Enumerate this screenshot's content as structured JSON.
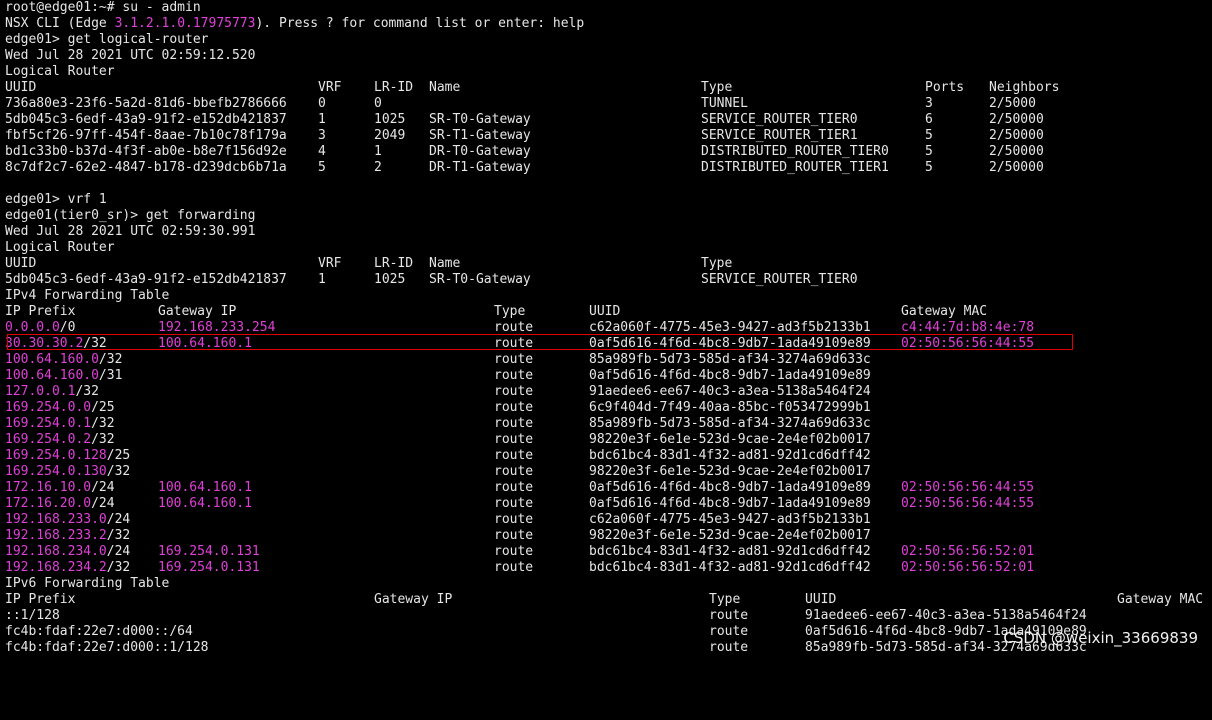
{
  "session": {
    "l1": "root@edge01:~# su - admin",
    "l2_pre": "NSX CLI (Edge ",
    "l2_ver": "3.1.2.1.0.17975773",
    "l2_post": "). Press ? for command list or enter: help",
    "l3": "edge01> get logical-router",
    "l4": "Wed Jul 28 2021 UTC 02:59:12.520",
    "l5": "Logical Router",
    "l12": "edge01> vrf 1",
    "l13": "edge01(tier0_sr)> get forwarding",
    "l14": "Wed Jul 28 2021 UTC 02:59:30.991",
    "l15": "Logical Router"
  },
  "lr_table": {
    "headers": {
      "uuid": "UUID",
      "vrf": "VRF",
      "lrid": "LR-ID",
      "name": "Name",
      "type": "Type",
      "ports": "Ports",
      "neighbors": "Neighbors"
    },
    "rows": [
      {
        "uuid": "736a80e3-23f6-5a2d-81d6-bbefb2786666",
        "vrf": "0",
        "lrid": "0",
        "name": "",
        "type": "TUNNEL",
        "ports": "3",
        "neighbors": "2/5000"
      },
      {
        "uuid": "5db045c3-6edf-43a9-91f2-e152db421837",
        "vrf": "1",
        "lrid": "1025",
        "name": "SR-T0-Gateway",
        "type": "SERVICE_ROUTER_TIER0",
        "ports": "6",
        "neighbors": "2/50000"
      },
      {
        "uuid": "fbf5cf26-97ff-454f-8aae-7b10c78f179a",
        "vrf": "3",
        "lrid": "2049",
        "name": "SR-T1-Gateway",
        "type": "SERVICE_ROUTER_TIER1",
        "ports": "5",
        "neighbors": "2/50000"
      },
      {
        "uuid": "bd1c33b0-b37d-4f3f-ab0e-b8e7f156d92e",
        "vrf": "4",
        "lrid": "1",
        "name": "DR-T0-Gateway",
        "type": "DISTRIBUTED_ROUTER_TIER0",
        "ports": "5",
        "neighbors": "2/50000"
      },
      {
        "uuid": "8c7df2c7-62e2-4847-b178-d239dcb6b71a",
        "vrf": "5",
        "lrid": "2",
        "name": "DR-T1-Gateway",
        "type": "DISTRIBUTED_ROUTER_TIER1",
        "ports": "5",
        "neighbors": "2/50000"
      }
    ]
  },
  "fwd_lr": {
    "headers": {
      "uuid": "UUID",
      "vrf": "VRF",
      "lrid": "LR-ID",
      "name": "Name",
      "type": "Type"
    },
    "row": {
      "uuid": "5db045c3-6edf-43a9-91f2-e152db421837",
      "vrf": "1",
      "lrid": "1025",
      "name": "SR-T0-Gateway",
      "type": "SERVICE_ROUTER_TIER0"
    }
  },
  "ipv4": {
    "title": "IPv4 Forwarding Table",
    "headers": {
      "prefix": "IP Prefix",
      "gw": "Gateway IP",
      "type": "Type",
      "uuid": "UUID",
      "mac": "Gateway MAC"
    },
    "rows": [
      {
        "net": "0.0.0.0",
        "mask": "/0",
        "gw": "192.168.233.254",
        "type": "route",
        "uuid": "c62a060f-4775-45e3-9427-ad3f5b2133b1",
        "mac": "c4:44:7d:b8:4e:78"
      },
      {
        "net": "30.30.30.2",
        "mask": "/32",
        "gw": "100.64.160.1",
        "type": "route",
        "uuid": "0af5d616-4f6d-4bc8-9db7-1ada49109e89",
        "mac": "02:50:56:56:44:55"
      },
      {
        "net": "100.64.160.0",
        "mask": "/32",
        "gw": "",
        "type": "route",
        "uuid": "85a989fb-5d73-585d-af34-3274a69d633c",
        "mac": ""
      },
      {
        "net": "100.64.160.0",
        "mask": "/31",
        "gw": "",
        "type": "route",
        "uuid": "0af5d616-4f6d-4bc8-9db7-1ada49109e89",
        "mac": ""
      },
      {
        "net": "127.0.0.1",
        "mask": "/32",
        "gw": "",
        "type": "route",
        "uuid": "91aedee6-ee67-40c3-a3ea-5138a5464f24",
        "mac": ""
      },
      {
        "net": "169.254.0.0",
        "mask": "/25",
        "gw": "",
        "type": "route",
        "uuid": "6c9f404d-7f49-40aa-85bc-f053472999b1",
        "mac": ""
      },
      {
        "net": "169.254.0.1",
        "mask": "/32",
        "gw": "",
        "type": "route",
        "uuid": "85a989fb-5d73-585d-af34-3274a69d633c",
        "mac": ""
      },
      {
        "net": "169.254.0.2",
        "mask": "/32",
        "gw": "",
        "type": "route",
        "uuid": "98220e3f-6e1e-523d-9cae-2e4ef02b0017",
        "mac": ""
      },
      {
        "net": "169.254.0.128",
        "mask": "/25",
        "gw": "",
        "type": "route",
        "uuid": "bdc61bc4-83d1-4f32-ad81-92d1cd6dff42",
        "mac": ""
      },
      {
        "net": "169.254.0.130",
        "mask": "/32",
        "gw": "",
        "type": "route",
        "uuid": "98220e3f-6e1e-523d-9cae-2e4ef02b0017",
        "mac": ""
      },
      {
        "net": "172.16.10.0",
        "mask": "/24",
        "gw": "100.64.160.1",
        "type": "route",
        "uuid": "0af5d616-4f6d-4bc8-9db7-1ada49109e89",
        "mac": "02:50:56:56:44:55"
      },
      {
        "net": "172.16.20.0",
        "mask": "/24",
        "gw": "100.64.160.1",
        "type": "route",
        "uuid": "0af5d616-4f6d-4bc8-9db7-1ada49109e89",
        "mac": "02:50:56:56:44:55"
      },
      {
        "net": "192.168.233.0",
        "mask": "/24",
        "gw": "",
        "type": "route",
        "uuid": "c62a060f-4775-45e3-9427-ad3f5b2133b1",
        "mac": ""
      },
      {
        "net": "192.168.233.2",
        "mask": "/32",
        "gw": "",
        "type": "route",
        "uuid": "98220e3f-6e1e-523d-9cae-2e4ef02b0017",
        "mac": ""
      },
      {
        "net": "192.168.234.0",
        "mask": "/24",
        "gw": "169.254.0.131",
        "type": "route",
        "uuid": "bdc61bc4-83d1-4f32-ad81-92d1cd6dff42",
        "mac": "02:50:56:56:52:01"
      },
      {
        "net": "192.168.234.2",
        "mask": "/32",
        "gw": "169.254.0.131",
        "type": "route",
        "uuid": "bdc61bc4-83d1-4f32-ad81-92d1cd6dff42",
        "mac": "02:50:56:56:52:01"
      }
    ]
  },
  "ipv6": {
    "title": "IPv6 Forwarding Table",
    "headers": {
      "prefix": "IP Prefix",
      "gw": "Gateway IP",
      "type": "Type",
      "uuid": "UUID",
      "mac": "Gateway MAC"
    },
    "rows": [
      {
        "prefix": "::1/128",
        "type": "route",
        "uuid": "91aedee6-ee67-40c3-a3ea-5138a5464f24"
      },
      {
        "prefix": "fc4b:fdaf:22e7:d000::/64",
        "type": "route",
        "uuid": "0af5d616-4f6d-4bc8-9db7-1ada49109e89"
      },
      {
        "prefix": "fc4b:fdaf:22e7:d000::1/128",
        "type": "route",
        "uuid": "85a989fb-5d73-585d-af34-3274a69d633c"
      }
    ]
  },
  "watermark": "CSDN @weixin_33669839",
  "colors": {
    "background": "#000000",
    "text": "#e6e6e6",
    "ip_highlight": "#e040d8",
    "selection_box": "#e00000"
  }
}
